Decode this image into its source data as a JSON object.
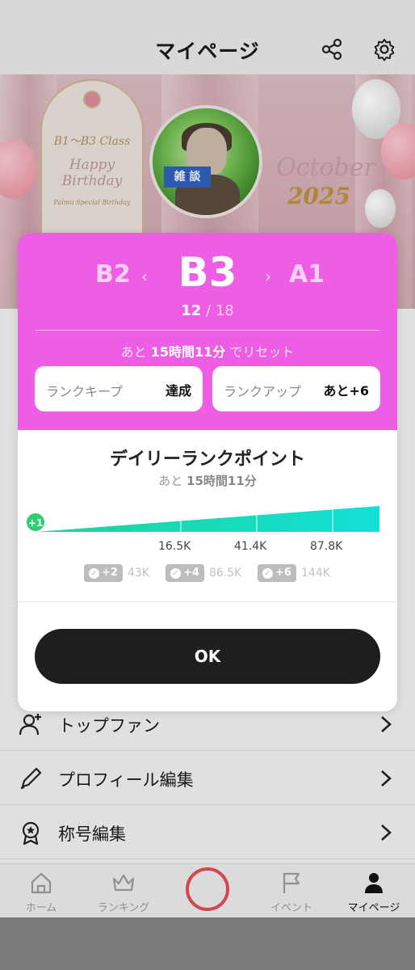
{
  "header": {
    "title": "マイページ",
    "share_icon": "share-icon",
    "settings_icon": "gear-icon"
  },
  "banner": {
    "sign_class": "B1～B3 Class",
    "sign_happy": "Happy",
    "sign_birthday": "Birthday",
    "sign_footer": "Palmu Special Birthday",
    "avatar_tag": "雑 談",
    "month": "October",
    "year": "2025"
  },
  "modal": {
    "prev_rank": "B2",
    "current_rank": "B3",
    "next_rank": "A1",
    "prev_arrow": "‹",
    "next_arrow": "›",
    "progress_current": "12",
    "progress_sep": " / ",
    "progress_total": "18",
    "reset_prefix": "あと ",
    "reset_time": "15時間11分",
    "reset_suffix": " でリセット",
    "keep_label": "ランクキープ",
    "keep_value": "達成",
    "up_label": "ランクアップ",
    "up_value": "あと+6",
    "daily_title": "デイリーランクポイント",
    "daily_prefix": "あと ",
    "daily_time": "15時間11分",
    "current_badge": "+1",
    "current_position": 0,
    "ticks": [
      "16.5K",
      "41.4K",
      "87.8K"
    ],
    "rewards": [
      {
        "bonus": "+2",
        "threshold": "43K"
      },
      {
        "bonus": "+4",
        "threshold": "86.5K"
      },
      {
        "bonus": "+6",
        "threshold": "144K"
      }
    ],
    "ok_label": "OK"
  },
  "menu": [
    {
      "label": "トップファン",
      "icon": "user-plus-icon"
    },
    {
      "label": "プロフィール編集",
      "icon": "pencil-icon"
    },
    {
      "label": "称号編集",
      "icon": "award-icon"
    }
  ],
  "tabs": [
    {
      "label": "ホーム",
      "icon": "home-icon"
    },
    {
      "label": "ランキング",
      "icon": "crown-icon"
    },
    {
      "label": "イベント",
      "icon": "flag-icon"
    },
    {
      "label": "マイページ",
      "icon": "user-icon"
    }
  ],
  "colors": {
    "rank_panel": "#ee5ee5",
    "bar_gradient_start": "#1fd39a",
    "bar_gradient_end": "#12e0d8",
    "ok_button": "#1e1e1e",
    "center_ring": "#e24a55"
  }
}
